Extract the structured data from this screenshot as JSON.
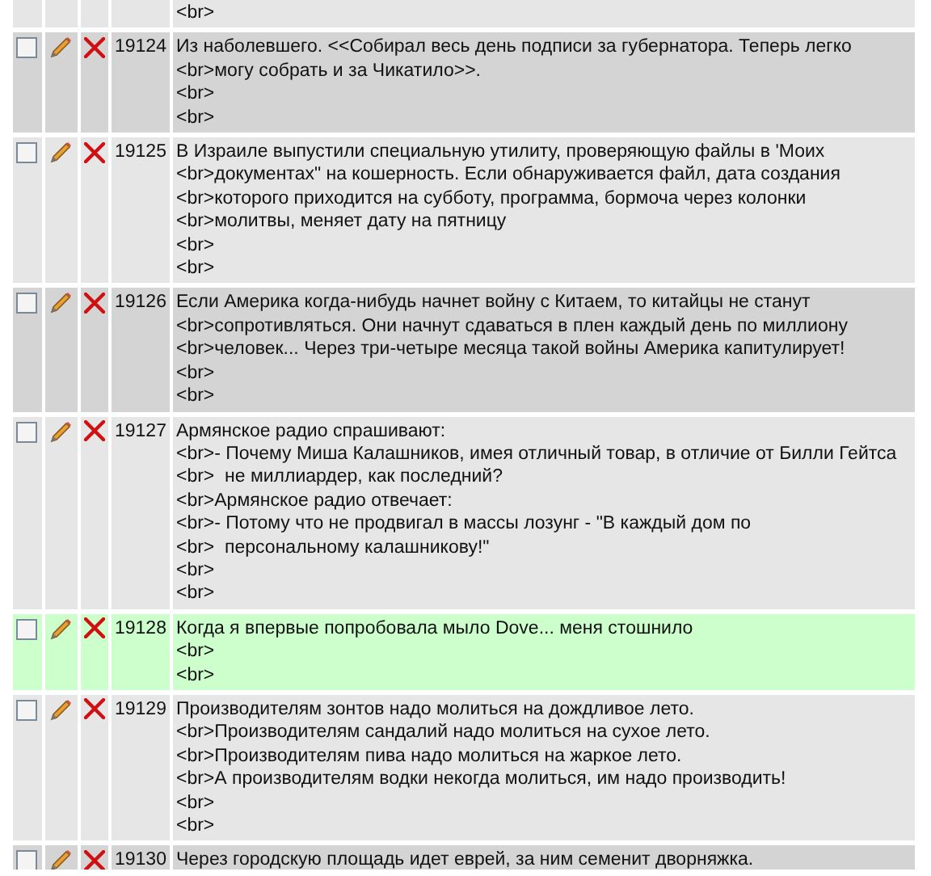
{
  "rows": [
    {
      "kind": "partial",
      "lines": [
        "<br>"
      ]
    },
    {
      "kind": "full",
      "checked": false,
      "highlighted": false,
      "id": "19124",
      "lines": [
        "Из наболевшего. <<Собирал весь день подписи за губернатора. Теперь легко",
        "<br>могу собрать и за Чикатило>>.",
        "<br>",
        "<br>"
      ]
    },
    {
      "kind": "full",
      "checked": false,
      "highlighted": false,
      "id": "19125",
      "lines": [
        "В Израиле выпустили специальную утилиту, проверяющую файлы в 'Моих",
        "<br>документах\" на кошерность. Если обнаруживается файл, дата создания",
        "<br>которого приходится на субботу, программа, бормоча через колонки",
        "<br>молитвы, меняет дату на пятницу",
        "<br>",
        "<br>"
      ]
    },
    {
      "kind": "full",
      "checked": false,
      "highlighted": false,
      "id": "19126",
      "lines": [
        "Если Америка когда-нибудь начнет войну с Китаем, то китайцы не станут",
        "<br>сопротивляться. Они начнут сдаваться в плен каждый день по миллиону",
        "<br>человек... Через три-четыре месяца такой войны Америка капитулирует!",
        "<br>",
        "<br>"
      ]
    },
    {
      "kind": "full",
      "checked": false,
      "highlighted": false,
      "id": "19127",
      "lines": [
        "Армянское радио спрашивают:",
        "<br>- Почему Миша Калашников, имея отличный товар, в отличие от Билли Гейтса",
        "<br>  не миллиардер, как последний?",
        "<br>Армянское радио отвечает:",
        "<br>- Потому что не продвигал в массы лозунг - \"В каждый дом по",
        "<br>  персональному калашникову!\"",
        "<br>",
        "<br>"
      ]
    },
    {
      "kind": "full",
      "checked": false,
      "highlighted": true,
      "id": "19128",
      "lines": [
        "Когда я впервые попробовала мыло Dove... меня стошнило",
        "<br>",
        "<br>"
      ]
    },
    {
      "kind": "full",
      "checked": false,
      "highlighted": false,
      "id": "19129",
      "lines": [
        "Производителям зонтов надо молиться на дождливое лето.",
        "<br>Производителям сандалий надо молиться на сухое лето.",
        "<br>Производителям пива надо молиться на жаркое лето.",
        "<br>А производителям водки некогда молиться, им надо производить!",
        "<br>",
        "<br>"
      ]
    },
    {
      "kind": "full",
      "checked": false,
      "highlighted": false,
      "id": "19130",
      "lines": [
        "Через городскую площадь идет еврей, за ним семенит дворняжка."
      ]
    }
  ]
}
